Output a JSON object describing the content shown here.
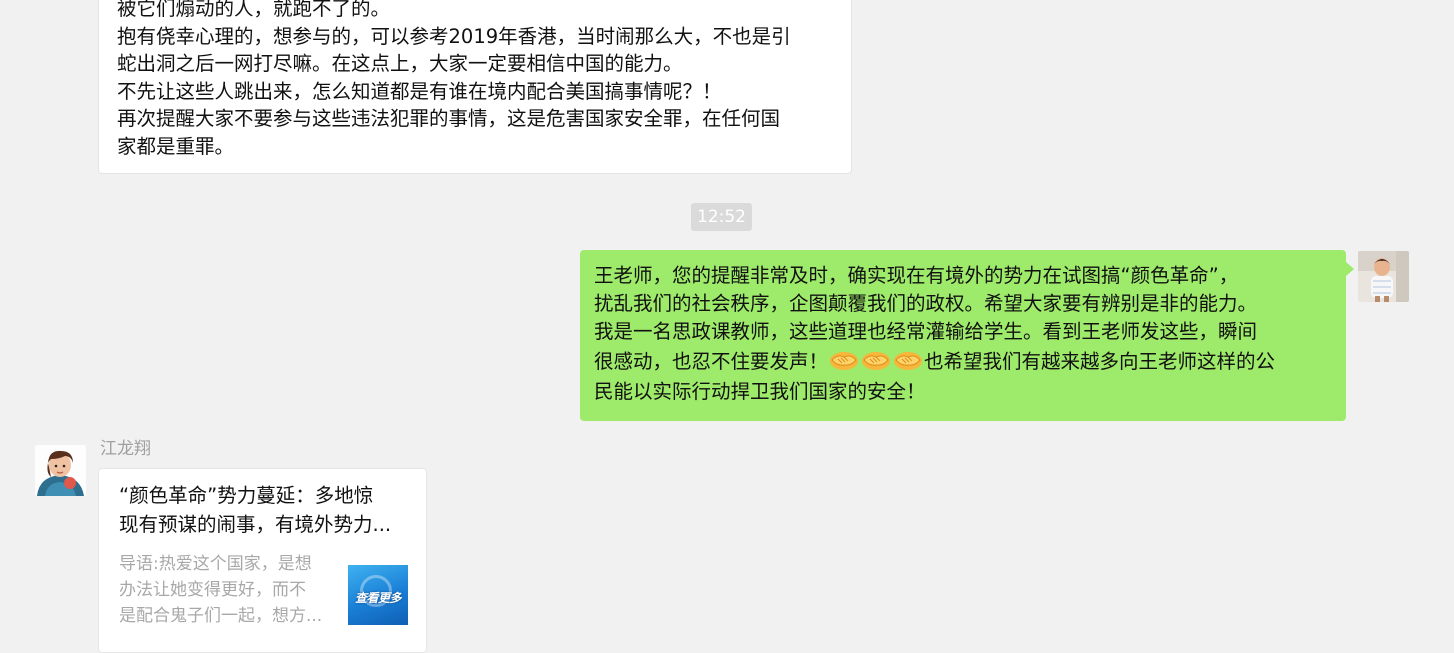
{
  "messages": {
    "incoming_top": {
      "lines": [
        "被它们煽动的人，就跑不了的。",
        "抱有侥幸心理的，想参与的，可以参考2019年香港，当时闹那么大，不也是引",
        "蛇出洞之后一网打尽嘛。在这点上，大家一定要相信中国的能力。",
        "不先让这些人跳出来，怎么知道都是有谁在境内配合美国搞事情呢？！",
        "再次提醒大家不要参与这些违法犯罪的事情，这是危害国家安全罪，在任何国",
        "家都是重罪。"
      ]
    },
    "timestamp": "12:52",
    "outgoing": {
      "lines": [
        "王老师，您的提醒非常及时，确实现在有境外的势力在试图搞“颜色革命”，",
        "扰乱我们的社会秩序，企图颠覆我们的政权。希望大家要有辨别是非的能力。",
        "我是一名思政课教师，这些道理也经常灌输给学生。看到王老师发这些，瞬间"
      ],
      "emoji_line_before": "很感动，也忍不住要发声！",
      "emoji_icon": "handshake-emoji",
      "emoji_count": 3,
      "emoji_line_after": "也希望我们有越来越多向王老师这样的公",
      "last_line": "民能以实际行动捍卫我们国家的安全！"
    },
    "link_card": {
      "sender_name": "江龙翔",
      "title_lines": [
        "“颜色革命”势力蔓延：多地惊",
        "现有预谋的闹事，有境外势力..."
      ],
      "desc_lines": [
        "导语:热爱这个国家，是想",
        "办法让她变得更好，而不",
        "是配合鬼子们一起，想方..."
      ],
      "thumb_text": "查看更多"
    }
  },
  "colors": {
    "chat_background": "#f1f1f1",
    "outgoing_bubble": "#9eea6a",
    "incoming_bubble": "#ffffff",
    "timestamp_bg": "#dadada"
  }
}
